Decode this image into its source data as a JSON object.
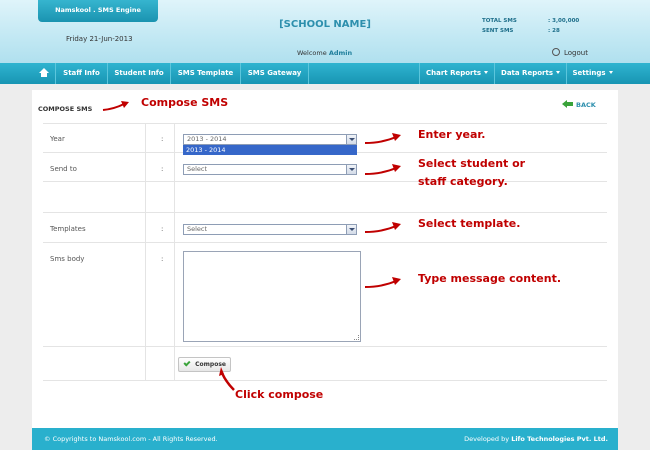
{
  "header": {
    "brand": "Namskool . SMS Engine",
    "date": "Friday 21-Jun-2013",
    "school_name": "[SCHOOL NAME]",
    "welcome_prefix": "Welcome",
    "welcome_user": "Admin",
    "total_sms_label": "TOTAL SMS",
    "total_sms_value": ": 3,00,000",
    "sent_sms_label": "SENT SMS",
    "sent_sms_value": ": 28",
    "logout": "Logout"
  },
  "nav": {
    "items": [
      {
        "label": "Staff Info"
      },
      {
        "label": "Student Info"
      },
      {
        "label": "SMS Template"
      },
      {
        "label": "SMS Gateway"
      }
    ],
    "right_items": [
      {
        "label": "Chart Reports"
      },
      {
        "label": "Data Reports"
      },
      {
        "label": "Settings"
      }
    ]
  },
  "page": {
    "title": "COMPOSE SMS",
    "back": "BACK"
  },
  "form": {
    "year": {
      "label": "Year",
      "value": "2013 - 2014",
      "dropdown_option": "2013 - 2014"
    },
    "send_to": {
      "label": "Send to",
      "value": "Select"
    },
    "templates": {
      "label": "Templates",
      "value": "Select"
    },
    "sms_body": {
      "label": "Sms body",
      "value": ""
    },
    "colon": ":",
    "compose_button": "Compose"
  },
  "annotations": {
    "compose_sms": "Compose SMS",
    "enter_year": "Enter year.",
    "select_category_1": "Select student or",
    "select_category_2": "staff category.",
    "select_template": "Select template.",
    "type_message": "Type message content.",
    "click_compose": "Click compose"
  },
  "footer": {
    "left": "© Copyrights to Namskool.com - All Rights Reserved.",
    "right_prefix": "Developed by",
    "right_company": "Lifo Technologies Pvt. Ltd."
  },
  "colors": {
    "nav": "#1fa4c2",
    "annotation": "#c00000",
    "accent": "#2d8fad"
  }
}
